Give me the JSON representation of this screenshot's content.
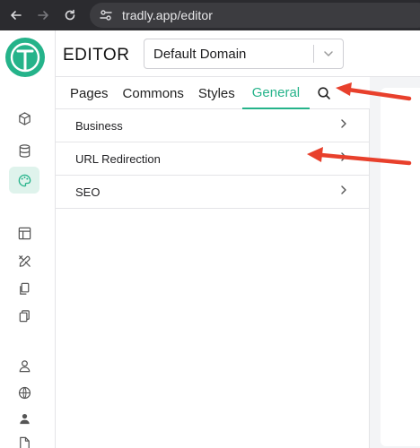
{
  "browser": {
    "url": "tradly.app/editor"
  },
  "header": {
    "title": "EDITOR",
    "domain_select": {
      "value": "Default Domain"
    }
  },
  "tabs": [
    {
      "label": "Pages"
    },
    {
      "label": "Commons"
    },
    {
      "label": "Styles"
    },
    {
      "label": "General",
      "active": true
    }
  ],
  "list": [
    {
      "label": "Business"
    },
    {
      "label": "URL Redirection"
    },
    {
      "label": "SEO"
    }
  ],
  "rail_icons": [
    "cube-icon",
    "database-icon",
    "palette-icon",
    "layout-icon",
    "tools-icon",
    "copy-icon",
    "duplicate-icon",
    "user-icon",
    "globe-icon",
    "users-icon",
    "file-icon"
  ],
  "colors": {
    "accent": "#25b38a",
    "annotation_arrow": "#e8402c",
    "browser_bar": "#2b2b2f"
  }
}
